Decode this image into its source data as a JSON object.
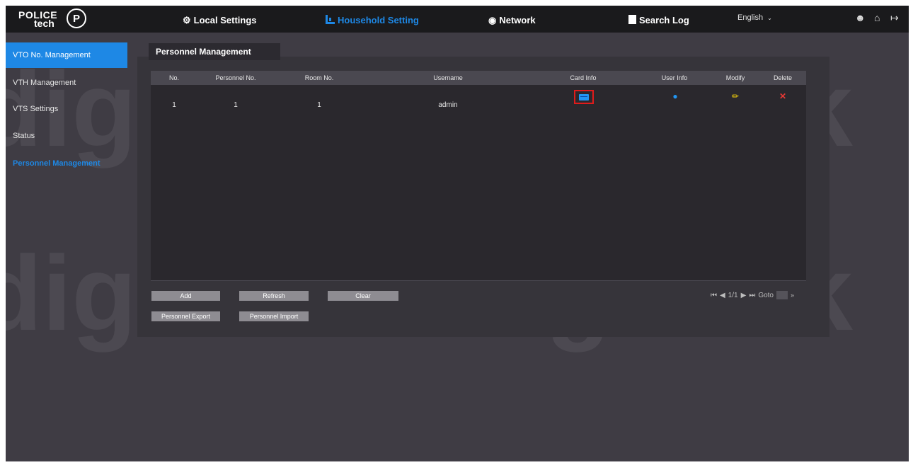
{
  "brand": {
    "line1": "POLICE",
    "line2": "tech",
    "badge": "P"
  },
  "nav": {
    "local_settings": "Local Settings",
    "household_setting": "Household Setting",
    "network": "Network",
    "search_log": "Search Log",
    "language": "English",
    "language_caret": "⌄"
  },
  "sidebar": {
    "items": [
      {
        "label": "VTO No. Management"
      },
      {
        "label": "VTH Management"
      },
      {
        "label": "VTS Settings"
      },
      {
        "label": "Status"
      },
      {
        "label": "Personnel Management"
      }
    ]
  },
  "panel": {
    "tab_title": "Personnel Management"
  },
  "table": {
    "headers": [
      "No.",
      "Personnel No.",
      "Room No.",
      "Username",
      "Card Info",
      "User Info",
      "Modify",
      "Delete"
    ],
    "rows": [
      {
        "no": "1",
        "personnel_no": "1",
        "room_no": "1",
        "username": "admin"
      }
    ]
  },
  "buttons": {
    "add": "Add",
    "refresh": "Refresh",
    "clear": "Clear",
    "personnel_export": "Personnel Export",
    "personnel_import": "Personnel Import"
  },
  "pager": {
    "page": "1/1",
    "goto_label": "Goto"
  },
  "watermark": "digitklik",
  "colors": {
    "accent": "#1e88e5",
    "highlight_box": "#e01b1b",
    "modify": "#f4d20b",
    "delete": "#e53935"
  },
  "icons": [
    "gear-icon",
    "grid-icon",
    "globe-icon",
    "log-icon",
    "user-icon",
    "home-icon",
    "logout-icon",
    "card-icon",
    "edit-icon",
    "delete-icon"
  ]
}
